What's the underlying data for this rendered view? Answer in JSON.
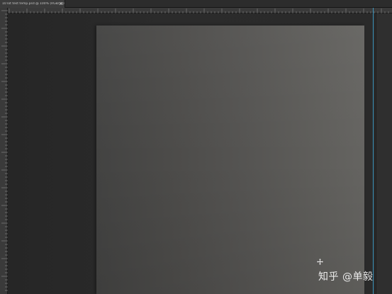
{
  "document_tab": {
    "title": "10 lot test temp.psd @ 100% (RGB/16)"
  },
  "rulers": {
    "top_numbers": [
      "",
      "",
      "",
      "",
      "",
      "",
      "",
      "",
      "",
      "",
      "",
      "",
      "",
      "",
      "",
      "",
      "",
      "",
      "",
      "",
      ""
    ],
    "left_numbers": []
  },
  "watermark": {
    "text": "知乎 @单毅"
  },
  "colors": {
    "guide": "#3ea7d6",
    "workspace": "#262626",
    "artboard": "#555452"
  },
  "icons": {
    "tab_close": "close-icon",
    "cursor": "move-cursor-icon"
  }
}
